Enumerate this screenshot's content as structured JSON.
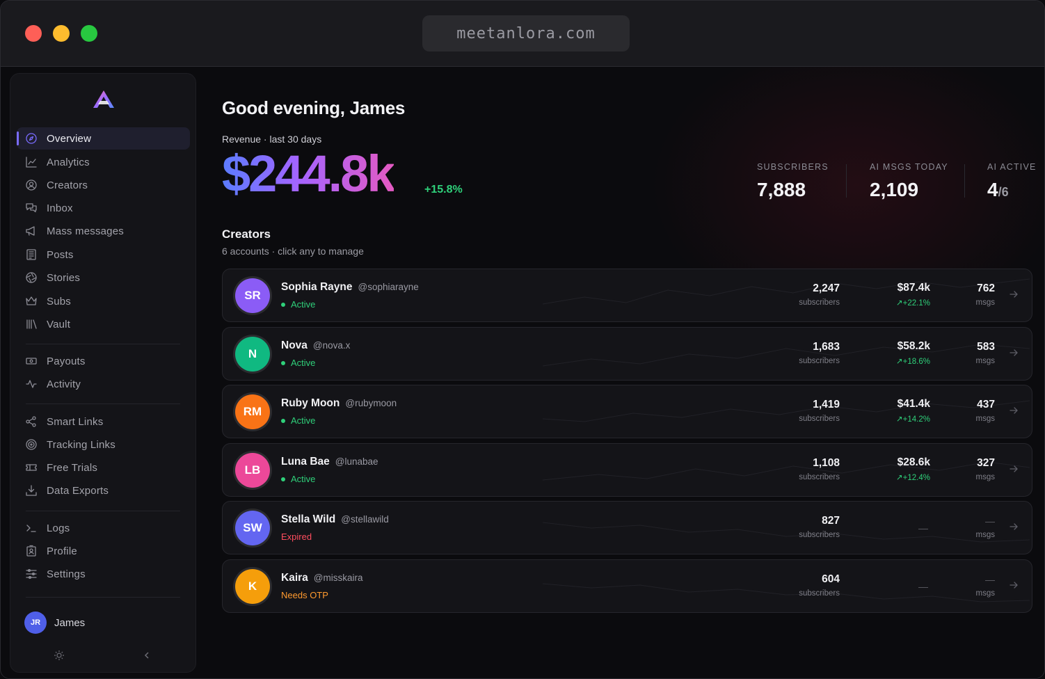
{
  "browser": {
    "url": "meetanlora.com"
  },
  "sidebar": {
    "items": [
      {
        "label": "Overview",
        "icon": "compass-icon",
        "active": true
      },
      {
        "label": "Analytics",
        "icon": "chart-icon"
      },
      {
        "label": "Creators",
        "icon": "user-circle-icon"
      },
      {
        "label": "Inbox",
        "icon": "chat-icon"
      },
      {
        "label": "Mass messages",
        "icon": "megaphone-icon"
      },
      {
        "label": "Posts",
        "icon": "newspaper-icon"
      },
      {
        "label": "Stories",
        "icon": "aperture-icon"
      },
      {
        "label": "Subs",
        "icon": "crown-icon"
      },
      {
        "label": "Vault",
        "icon": "library-icon"
      },
      {
        "label": "Payouts",
        "icon": "banknote-icon"
      },
      {
        "label": "Activity",
        "icon": "activity-icon"
      },
      {
        "label": "Smart Links",
        "icon": "share-nodes-icon"
      },
      {
        "label": "Tracking Links",
        "icon": "target-icon"
      },
      {
        "label": "Free Trials",
        "icon": "ticket-icon"
      },
      {
        "label": "Data Exports",
        "icon": "download-icon"
      },
      {
        "label": "Logs",
        "icon": "terminal-icon"
      },
      {
        "label": "Profile",
        "icon": "badge-icon"
      },
      {
        "label": "Settings",
        "icon": "sliders-icon"
      }
    ],
    "user": {
      "initials": "JR",
      "name": "James"
    }
  },
  "main": {
    "greeting": "Good evening, James",
    "revenue": {
      "label": "Revenue · last 30 days",
      "value": "$244.8k",
      "change": "+15.8%"
    },
    "stats": [
      {
        "label": "SUBSCRIBERS",
        "value": "7,888"
      },
      {
        "label": "AI MSGS TODAY",
        "value": "2,109"
      },
      {
        "label": "AI ACTIVE",
        "value": "4",
        "suffix": "/6"
      }
    ],
    "creators_title": "Creators",
    "creators_subtitle": "6 accounts · click any to manage",
    "creators": [
      {
        "initials": "SR",
        "name": "Sophia Rayne",
        "handle": "@sophiarayne",
        "status": "Active",
        "subscribers": "2,247",
        "subs_label": "subscribers",
        "revenue": "$87.4k",
        "growth": "+22.1%",
        "msgs": "762",
        "msgs_label": "msgs",
        "color": "#8b5cf6"
      },
      {
        "initials": "N",
        "name": "Nova",
        "handle": "@nova.x",
        "status": "Active",
        "subscribers": "1,683",
        "subs_label": "subscribers",
        "revenue": "$58.2k",
        "growth": "+18.6%",
        "msgs": "583",
        "msgs_label": "msgs",
        "color": "#10b981"
      },
      {
        "initials": "RM",
        "name": "Ruby Moon",
        "handle": "@rubymoon",
        "status": "Active",
        "subscribers": "1,419",
        "subs_label": "subscribers",
        "revenue": "$41.4k",
        "growth": "+14.2%",
        "msgs": "437",
        "msgs_label": "msgs",
        "color": "#f97316"
      },
      {
        "initials": "LB",
        "name": "Luna Bae",
        "handle": "@lunabae",
        "status": "Active",
        "subscribers": "1,108",
        "subs_label": "subscribers",
        "revenue": "$28.6k",
        "growth": "+12.4%",
        "msgs": "327",
        "msgs_label": "msgs",
        "color": "#ec4899"
      },
      {
        "initials": "SW",
        "name": "Stella Wild",
        "handle": "@stellawild",
        "status": "Expired",
        "subscribers": "827",
        "subs_label": "subscribers",
        "revenue": "",
        "growth": "",
        "msgs": "",
        "msgs_label": "msgs",
        "color": "#6366f1"
      },
      {
        "initials": "K",
        "name": "Kaira",
        "handle": "@misskaira",
        "status": "Needs OTP",
        "subscribers": "604",
        "subs_label": "subscribers",
        "revenue": "",
        "growth": "",
        "msgs": "",
        "msgs_label": "msgs",
        "color": "#f59e0b"
      }
    ]
  },
  "colors": {
    "accent": "#7a6cff",
    "positive": "#2fd07a",
    "expired": "#ff4d5e",
    "warning": "#ff9a2e"
  }
}
